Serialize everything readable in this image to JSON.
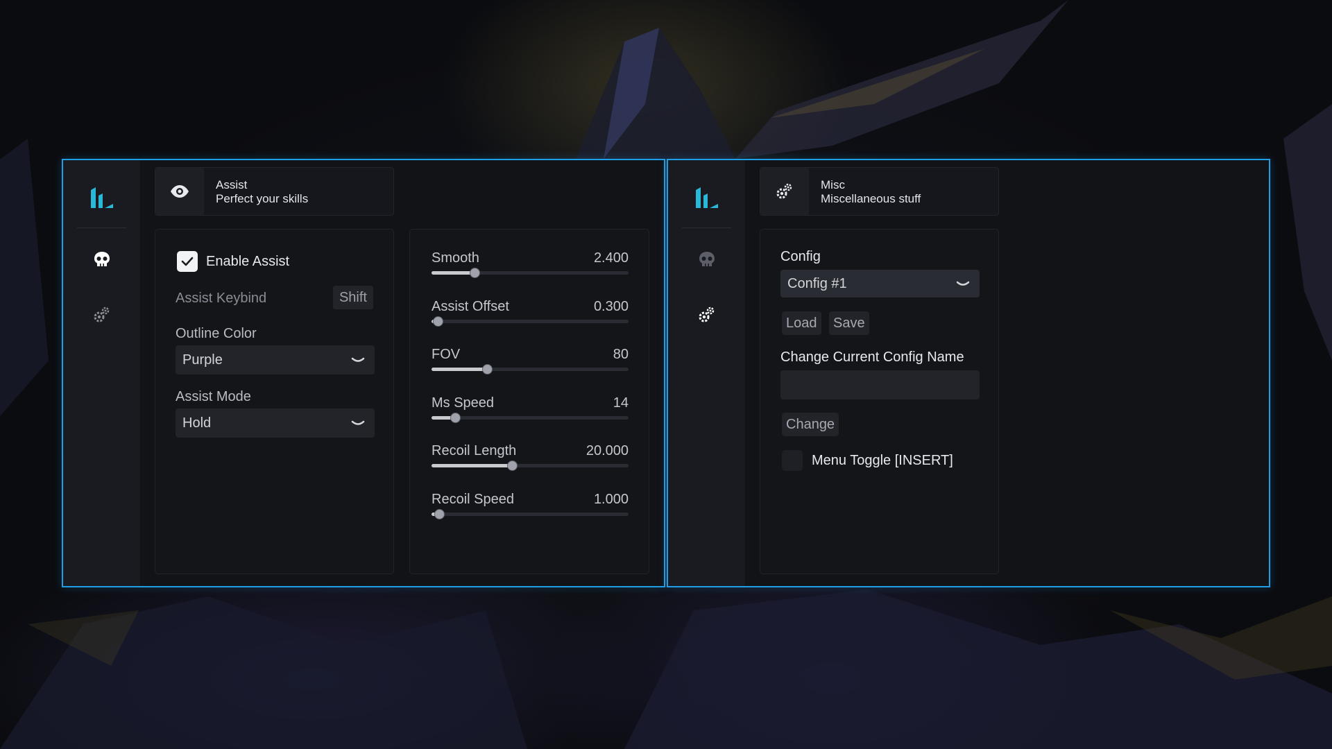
{
  "colors": {
    "accent": "#1f9ee8",
    "logo": "#2ab8d8",
    "window_bg": "#121317",
    "sidebar_bg": "#1a1b20"
  },
  "left_window": {
    "sidebar": {
      "icons": [
        "logo-icon",
        "skull-icon",
        "gears-icon"
      ],
      "active": "skull-icon"
    },
    "header": {
      "icon": "eye-icon",
      "title": "Assist",
      "subtitle": "Perfect your skills"
    },
    "settings": {
      "enable_label": "Enable Assist",
      "enable_checked": true,
      "keybind_label": "Assist Keybind",
      "keybind_value": "Shift",
      "outline_label": "Outline Color",
      "outline_value": "Purple",
      "mode_label": "Assist Mode",
      "mode_value": "Hold"
    },
    "sliders": [
      {
        "label": "Smooth",
        "value": "2.400",
        "fraction": 0.22
      },
      {
        "label": "Assist Offset",
        "value": "0.300",
        "fraction": 0.03
      },
      {
        "label": "FOV",
        "value": "80",
        "fraction": 0.28
      },
      {
        "label": "Ms Speed",
        "value": "14",
        "fraction": 0.12
      },
      {
        "label": "Recoil Length",
        "value": "20.000",
        "fraction": 0.41
      },
      {
        "label": "Recoil Speed",
        "value": "1.000",
        "fraction": 0.04
      }
    ]
  },
  "right_window": {
    "sidebar": {
      "icons": [
        "logo-icon",
        "skull-icon",
        "gears-icon"
      ],
      "active": "gears-icon"
    },
    "header": {
      "icon": "gears-icon",
      "title": "Misc",
      "subtitle": "Miscellaneous stuff"
    },
    "config": {
      "label": "Config",
      "selected": "Config #1",
      "load_label": "Load",
      "save_label": "Save",
      "rename_label": "Change Current Config Name",
      "rename_value": "",
      "change_label": "Change",
      "menu_toggle_label": "Menu Toggle [INSERT]",
      "menu_toggle_checked": false
    }
  }
}
